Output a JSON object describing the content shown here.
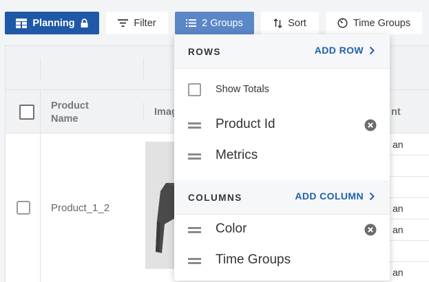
{
  "toolbar": {
    "planning_label": "Planning",
    "filter_label": "Filter",
    "groups_label": "2 Groups",
    "sort_label": "Sort",
    "time_groups_label": "Time Groups"
  },
  "table": {
    "columns": [
      "Product Name",
      "Imag",
      "nt"
    ],
    "column_name_line1": "Product",
    "column_name_line2": "Name",
    "column_image": "Imag",
    "column_right": "nt",
    "rows": [
      {
        "product_name": "Product_1_2"
      }
    ],
    "right_column_values": [
      "an",
      "",
      "",
      "an",
      "an",
      "",
      "an"
    ]
  },
  "dropdown": {
    "rows_title": "ROWS",
    "add_row_label": "ADD ROW",
    "show_totals_label": "Show Totals",
    "show_totals_checked": false,
    "row_items": [
      "Product Id",
      "Metrics"
    ],
    "columns_title": "COLUMNS",
    "add_column_label": "ADD COLUMN",
    "column_items": [
      "Color",
      "Time Groups"
    ]
  },
  "colors": {
    "primary": "#1f58a6",
    "active_button": "#5b87c7",
    "link": "#2160ad"
  }
}
